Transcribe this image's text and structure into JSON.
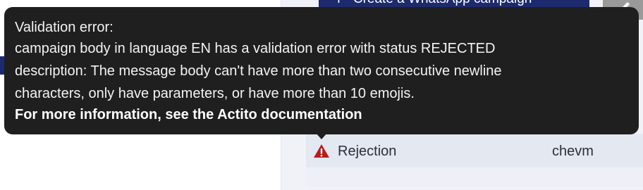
{
  "header": {
    "create_button_label": "Create a WhatsApp campaign",
    "create_button_icon": "plus-icon",
    "edit_button_icon": "pencil-icon"
  },
  "tooltip": {
    "title": "Validation error:",
    "message_line_1": "campaign body in language EN has a validation error with status REJECTED",
    "message_line_2": "description: The message body can't have more than two consecutive newline",
    "message_line_3": "characters, only have parameters, or have more than 10 emojis.",
    "link_text": "For more information, see the Actito documentation"
  },
  "table": {
    "row": {
      "status_label": "Rejection",
      "status_icon": "warning-icon",
      "status_color": "#b71c1c",
      "user": "chevm"
    }
  },
  "colors": {
    "tooltip_bg": "#1f1f1f",
    "brand_navy": "#1d2a6d",
    "panel_bg": "#f0f2f7"
  }
}
